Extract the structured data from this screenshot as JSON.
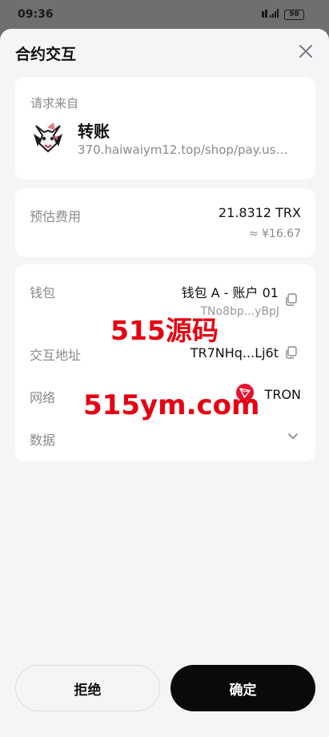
{
  "status_bar": {
    "time": "09:36",
    "battery": "98"
  },
  "sheet": {
    "title": "合约交互"
  },
  "request": {
    "label": "请求来自",
    "title": "转账",
    "url": "370.haiwaiym12.top/shop/pay.us…"
  },
  "fee": {
    "label": "预估费用",
    "amount": "21.8312 TRX",
    "fiat": "≈ ¥16.67"
  },
  "details": {
    "wallet_label": "钱包",
    "wallet_name": "钱包 A - 账户 01",
    "wallet_address": "TNo8bp...yBpJ",
    "contract_label": "交互地址",
    "contract_address": "TR7NHq...Lj6t",
    "network_label": "网络",
    "network_name": "TRON",
    "data_label": "数据"
  },
  "watermark": {
    "line1": "515源码",
    "line2": "515ym.com"
  },
  "actions": {
    "reject": "拒绝",
    "confirm": "确定"
  },
  "colors": {
    "primary_button": "#0a0a0a",
    "tron_red": "#e8112d",
    "watermark_red": "#e60012"
  }
}
